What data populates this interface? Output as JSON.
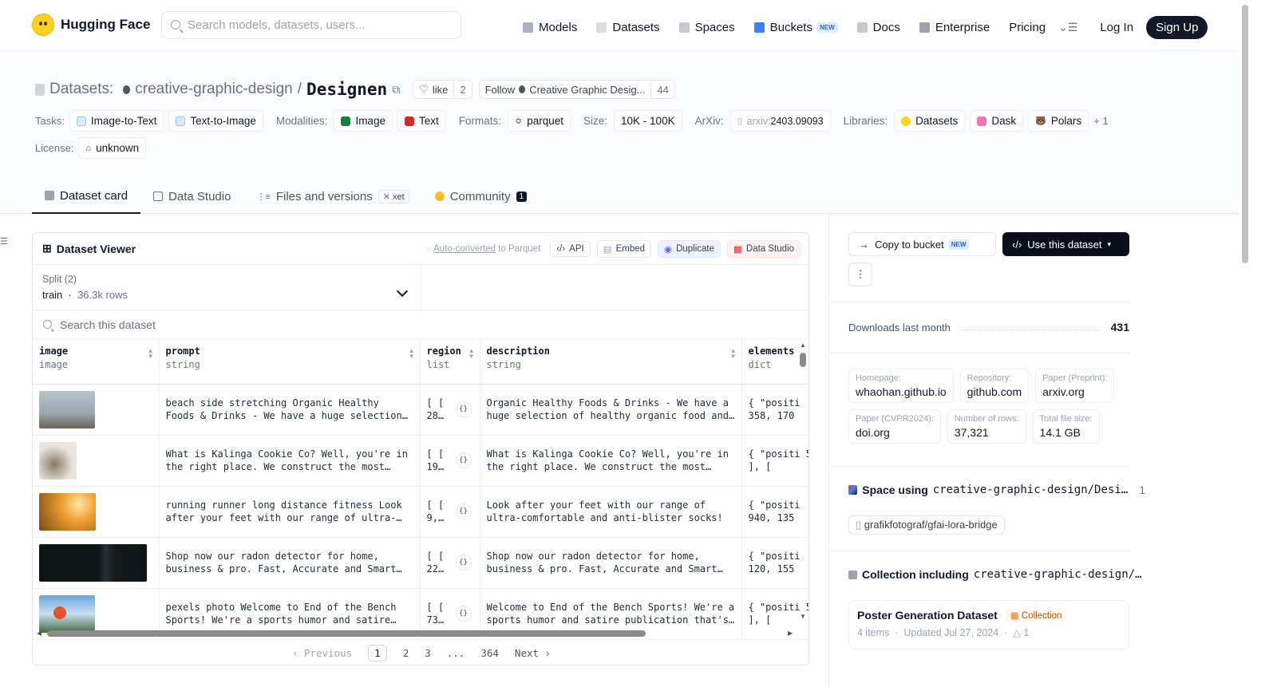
{
  "nav": {
    "brand": "Hugging Face",
    "search_placeholder": "Search models, datasets, users...",
    "links": [
      "Models",
      "Datasets",
      "Spaces",
      "Buckets",
      "Docs",
      "Enterprise",
      "Pricing"
    ],
    "buckets_badge": "NEW",
    "login": "Log In",
    "signup": "Sign Up"
  },
  "header": {
    "datasets_label": "Datasets:",
    "org": "creative-graphic-design",
    "sep": "/",
    "repo": "Designen",
    "like": "like",
    "like_count": "2",
    "follow": "Follow",
    "follow_org": "Creative Graphic Desig...",
    "follow_count": "44",
    "tasks_label": "Tasks:",
    "tasks": [
      "Image-to-Text",
      "Text-to-Image"
    ],
    "modalities_label": "Modalities:",
    "modalities": [
      "Image",
      "Text"
    ],
    "formats_label": "Formats:",
    "formats": [
      "parquet"
    ],
    "size_label": "Size:",
    "size": "10K - 100K",
    "arxiv_label": "ArXiv:",
    "arxiv_prefix": "arxiv:",
    "arxiv": "2403.09093",
    "libraries_label": "Libraries:",
    "libraries": [
      "Datasets",
      "Dask",
      "Polars"
    ],
    "libraries_more": "+ 1",
    "license_label": "License:",
    "license": "unknown",
    "tabs": [
      "Dataset card",
      "Data Studio",
      "Files and versions",
      "Community"
    ],
    "xet": "xet",
    "community_count": "1"
  },
  "viewer": {
    "title": "Dataset Viewer",
    "auto_converted": "Auto-converted",
    "to_parquet": "to Parquet",
    "actions": [
      "API",
      "Embed",
      "Duplicate",
      "Data Studio"
    ],
    "split_label": "Split (2)",
    "split_value": "train",
    "split_rows": "36.3k rows",
    "search_placeholder": "Search this dataset",
    "columns": [
      {
        "name": "image",
        "type": "image"
      },
      {
        "name": "prompt",
        "type": "string"
      },
      {
        "name": "region",
        "type": "list"
      },
      {
        "name": "description",
        "type": "string"
      },
      {
        "name": "elements",
        "type": "dict"
      }
    ],
    "rows": [
      {
        "prompt": "beach side stretching Organic Healthy Foods & Drinks - We have a huge selection of…",
        "region": "[ [ 28…",
        "description": "Organic Healthy Foods & Drinks - We have a huge selection of healthy organic food and…",
        "elements": "{ \"positi 358, 170"
      },
      {
        "prompt": "What is Kalinga Cookie Co? Well, you're in the right place. We construct the most…",
        "region": "[ [ 19…",
        "description": "What is Kalinga Cookie Co? Well, you're in the right place. We construct the most…",
        "elements": "{ \"positi 560 ], ["
      },
      {
        "prompt": "running runner long distance fitness Look after your feet with our range of ultra-…",
        "region": "[ [ 9,…",
        "description": "Look after your feet with our range of ultra-comfortable and anti-blister socks!",
        "elements": "{ \"positi 940, 135"
      },
      {
        "prompt": "Shop now our radon detector for home, business & pro. Fast, Accurate and Smart…",
        "region": "[ [ 22…",
        "description": "Shop now our radon detector for home, business & pro. Fast, Accurate and Smart…",
        "elements": "{ \"positi 120, 155"
      },
      {
        "prompt": "pexels photo Welcome to End of the Bench Sports! We're a sports humor and satire…",
        "region": "[ [ 73…",
        "description": "Welcome to End of the Bench Sports! We're a sports humor and satire publication that's…",
        "elements": "{ \"positi 560 ], ["
      }
    ],
    "pager": {
      "prev": "Previous",
      "pages": [
        "1",
        "2",
        "3",
        "...",
        "364"
      ],
      "next": "Next"
    }
  },
  "sidebar": {
    "copy_to_bucket": "Copy to bucket",
    "copy_badge": "NEW",
    "use_dataset": "Use this dataset",
    "downloads_label": "Downloads last month",
    "downloads": "431",
    "meta": [
      {
        "k": "Homepage:",
        "v": "whaohan.github.io"
      },
      {
        "k": "Repository:",
        "v": "github.com"
      },
      {
        "k": "Paper (Preprint):",
        "v": "arxiv.org"
      },
      {
        "k": "Paper (CVPR2024):",
        "v": "doi.org"
      },
      {
        "k": "Number of rows:",
        "v": "37,321"
      },
      {
        "k": "Total file size:",
        "v": "14.1 GB"
      }
    ],
    "space_title": "Space using",
    "space_repo": "creative-graphic-design/Desi…",
    "space_count": "1",
    "space_item": "grafikfotograf/gfai-lora-bridge",
    "collection_title": "Collection including",
    "collection_repo": "creative-graphic-design/…",
    "collection_name": "Poster Generation Dataset",
    "collection_badge": "Collection",
    "collection_items": "4 items",
    "collection_updated": "Updated Jul 27, 2024",
    "collection_likes": "1"
  }
}
